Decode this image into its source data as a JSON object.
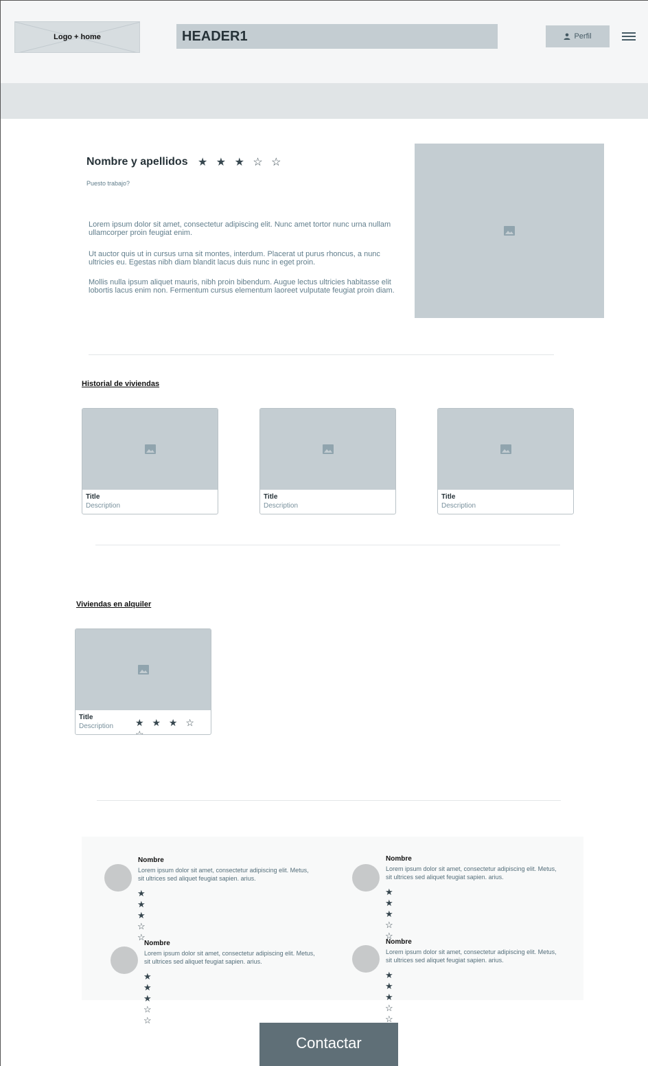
{
  "header": {
    "logo_label": "Logo + home",
    "title": "HEADER1",
    "perfil_label": "Perfil"
  },
  "profile": {
    "name": "Nombre y apellidos",
    "stars": "★ ★ ★ ☆ ☆",
    "rating": 3,
    "rating_max": 5,
    "role": "Puesto trabajo?",
    "paragraphs": [
      "Lorem ipsum dolor sit amet, consectetur adipiscing elit. Nunc amet tortor nunc urna nullam ullamcorper proin feugiat enim.",
      "Ut auctor quis ut in cursus urna sit montes, interdum. Placerat ut purus rhoncus, a nunc ultricies eu. Egestas nibh diam blandit lacus duis nunc in eget proin.",
      "Mollis nulla ipsum aliquet mauris, nibh proin bibendum. Augue lectus ultricies habitasse elit lobortis lacus enim non. Fermentum cursus elementum laoreet vulputate feugiat proin diam."
    ]
  },
  "historial": {
    "title": "Historial de viviendas",
    "cards": [
      {
        "title": "Title",
        "description": "Description"
      },
      {
        "title": "Title",
        "description": "Description"
      },
      {
        "title": "Title",
        "description": "Description"
      }
    ]
  },
  "alquiler": {
    "title": "Viviendas en alquiler",
    "cards": [
      {
        "title": "Title",
        "description": "Description",
        "stars": "★ ★ ★ ☆ ☆",
        "rating": 3
      }
    ]
  },
  "reviews": [
    {
      "name": "Nombre",
      "text": "Lorem ipsum dolor sit amet, consectetur adipiscing elit. Metus, sit ultrices sed aliquet feugiat sapien. arius.",
      "stars": "★ ★ ★ ☆ ☆",
      "rating": 3
    },
    {
      "name": "Nombre",
      "text": "Lorem ipsum dolor sit amet, consectetur adipiscing elit. Metus, sit ultrices sed aliquet feugiat sapien. arius.",
      "stars": "★ ★ ★ ☆ ☆",
      "rating": 3
    },
    {
      "name": "Nombre",
      "text": "Lorem ipsum dolor sit amet, consectetur adipiscing elit. Metus, sit ultrices sed aliquet feugiat sapien. arius.",
      "stars": "★ ★ ★ ☆ ☆",
      "rating": 3
    },
    {
      "name": "Nombre",
      "text": "Lorem ipsum dolor sit amet, consectetur adipiscing elit. Metus, sit ultrices sed aliquet feugiat sapien. arius.",
      "stars": "★ ★ ★ ☆ ☆",
      "rating": 3
    }
  ],
  "contact": {
    "label": "Contactar"
  },
  "colors": {
    "placeholder": "#c4cdd2",
    "button_dark": "#5f6f77",
    "star": "#37474f"
  },
  "icons": {
    "image": "image-icon",
    "user": "user-icon",
    "menu": "menu-icon"
  }
}
